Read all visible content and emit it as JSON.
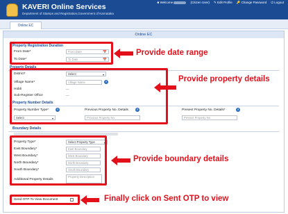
{
  "header": {
    "title": "KAVERI Online Services",
    "subtitle": "Department of Stamps and Registration,Government of Karnataka",
    "links": [
      "Welcome",
      "(Citizen User)",
      "Edit Profile",
      "Change Password",
      "Logout"
    ]
  },
  "tab": {
    "label": "Online EC"
  },
  "panel": {
    "title": "Online EC"
  },
  "registration": {
    "heading": "Property Registration Duration",
    "from_label": "From Date*",
    "from_placeholder": "From Date",
    "to_label": "To Date*",
    "to_placeholder": "To Date"
  },
  "property_details": {
    "heading": "Property Details",
    "district_label": "District*",
    "district_value": "Select",
    "village_label": "Village Name*",
    "village_placeholder": "Village Name",
    "hobli_label": "Hobli",
    "hobli_value": "---",
    "sro_label": "Sub-Register Office",
    "sro_value": "---"
  },
  "property_number": {
    "heading": "Property Number Details",
    "type_label": "Property Number Type*",
    "type_value": "Select",
    "prev_label": "Previous Property No. Details",
    "prev_placeholder": "Previous Property No",
    "present_label": "Present Property No. Details*",
    "present_placeholder": "Present Property No"
  },
  "boundary": {
    "heading": "Boundary Details",
    "type_label": "Property Type*",
    "type_value": "Select Property Type",
    "east_label": "East Boundary*",
    "east_placeholder": "East Boundary",
    "west_label": "West Boundary*",
    "west_placeholder": "West Boundary",
    "north_label": "North Boundary*",
    "north_placeholder": "North Boundary",
    "south_label": "South Boundary*",
    "south_placeholder": "South Boundary",
    "additional_label": "Additional Property Details",
    "additional_placeholder": "Property Description"
  },
  "otp": {
    "label": "Send OTP To View Document"
  },
  "annotations": {
    "date": "Provide date range",
    "property": "Provide property details",
    "boundary": "Provide boundary details",
    "otp": "Finally click on Sent OTP to view"
  },
  "colors": {
    "header_bg": "#1a4b93",
    "annotation": "#e3101c",
    "help_icon": "#2a6ebd"
  },
  "icons": {
    "calendar": "calendar-icon",
    "help": "help-icon",
    "emblem": "karnataka-emblem"
  }
}
